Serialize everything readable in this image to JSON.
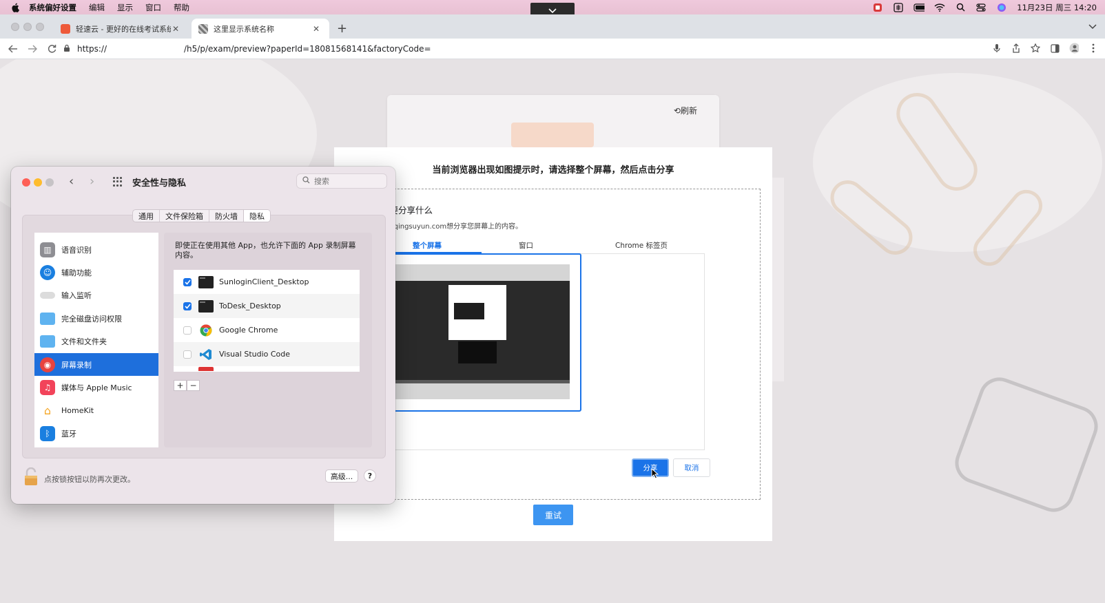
{
  "menubar": {
    "items": [
      "系统偏好设置",
      "编辑",
      "显示",
      "窗口",
      "帮助"
    ],
    "clock": "11月23日 周三 14:20"
  },
  "browser": {
    "tabs": [
      {
        "label": "轻速云 - 更好的在线考试系统和培",
        "active": false
      },
      {
        "label": "这里显示系统名称",
        "active": true
      }
    ],
    "url_scheme": "https://",
    "url_path": "/h5/p/exam/preview?paperId=18081568141&factoryCode="
  },
  "page": {
    "refresh_label": "刷新",
    "share_dialog": {
      "heading": "当前浏览器出现如图提示时，请选择整个屏幕，然后点击分享",
      "picker_title": "择要分享什么",
      "picker_subtitle": "ww.qingsuyun.com想分享您屏幕上的内容。",
      "tabs": [
        "整个屏幕",
        "窗口",
        "Chrome 标签页"
      ],
      "share_button": "分享",
      "cancel_button": "取消"
    },
    "retry_button": "重试"
  },
  "sysprefs": {
    "title": "安全性与隐私",
    "search_placeholder": "搜索",
    "segments": [
      "通用",
      "文件保险箱",
      "防火墙",
      "隐私"
    ],
    "selected_segment": "隐私",
    "sidebar": [
      {
        "label": "语音识别",
        "icon": "waveform-icon",
        "color": "#8e8e93"
      },
      {
        "label": "辅助功能",
        "icon": "accessibility-icon",
        "color": "#1a7fe0"
      },
      {
        "label": "输入监听",
        "icon": "keyboard-icon",
        "color": "#d9d9d9"
      },
      {
        "label": "完全磁盘访问权限",
        "icon": "folder-icon",
        "color": "#5fb3f0"
      },
      {
        "label": "文件和文件夹",
        "icon": "folder-icon",
        "color": "#5fb3f0"
      },
      {
        "label": "屏幕录制",
        "icon": "screen-record-icon",
        "color": "#e8433f",
        "selected": true
      },
      {
        "label": "媒体与 Apple Music",
        "icon": "music-icon",
        "color": "#f2435a"
      },
      {
        "label": "HomeKit",
        "icon": "home-icon",
        "color": "#f5a623"
      },
      {
        "label": "蓝牙",
        "icon": "bluetooth-icon",
        "color": "#1a7fe0"
      }
    ],
    "description": "即使正在使用其他 App，也允许下面的 App 录制屏幕内容。",
    "apps": [
      {
        "name": "SunloginClient_Desktop",
        "checked": true,
        "icon": "terminal-icon"
      },
      {
        "name": "ToDesk_Desktop",
        "checked": true,
        "icon": "terminal-icon"
      },
      {
        "name": "Google Chrome",
        "checked": false,
        "icon": "chrome-icon"
      },
      {
        "name": "Visual Studio Code",
        "checked": false,
        "icon": "vscode-icon"
      }
    ],
    "add_label": "+",
    "remove_label": "−",
    "lock_text": "点按锁按钮以防再次更改。",
    "advanced_label": "高级...",
    "help_label": "?"
  }
}
